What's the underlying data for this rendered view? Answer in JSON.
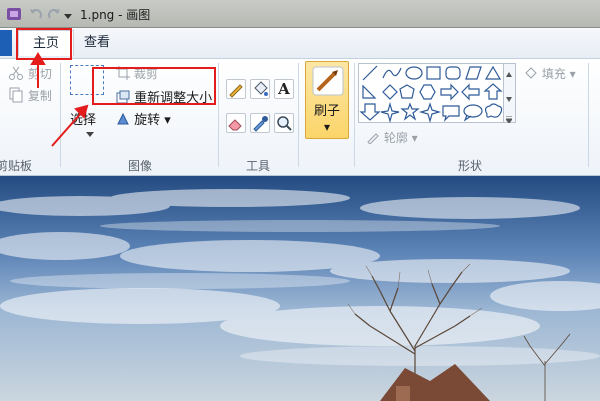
{
  "window": {
    "title": "1.png - 画图"
  },
  "tabs": [
    {
      "label": "主页"
    },
    {
      "label": "查看"
    }
  ],
  "clipboard": {
    "cut_label": "剪切",
    "copy_label": "复制",
    "group_label": "剪贴板"
  },
  "image": {
    "crop_label": "裁剪",
    "resize_label": "重新调整大小",
    "select_label": "选择",
    "rotate_label": "旋转",
    "group_label": "图像"
  },
  "tools": {
    "group_label": "工具"
  },
  "brush": {
    "label": "刷子"
  },
  "shapes": {
    "outline_label": "轮廓",
    "fill_label": "填充",
    "group_label": "形状"
  },
  "colors": {
    "annotation": "#e41c1c",
    "file_tab": "#1c5fb5",
    "brush_highlight": "#fbd56a"
  }
}
